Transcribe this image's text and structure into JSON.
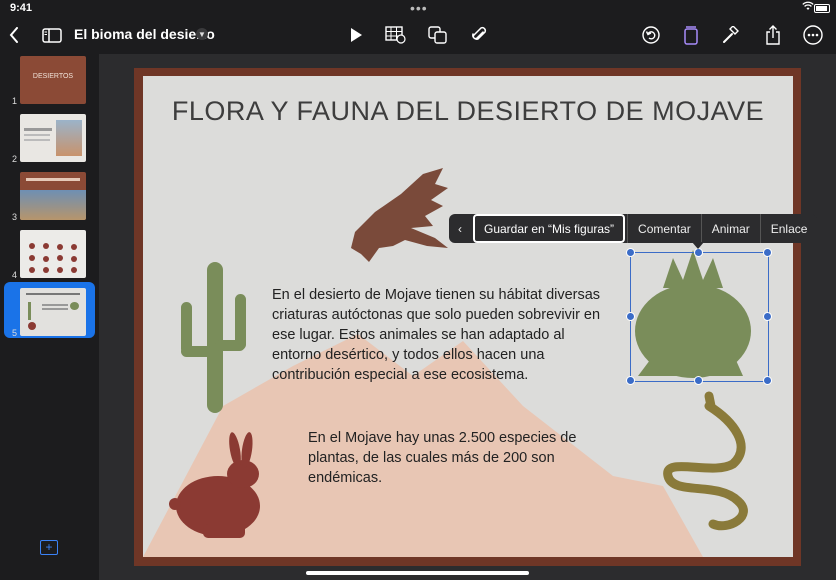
{
  "status": {
    "time": "9:41"
  },
  "toolbar": {
    "title": "El bioma del desierto"
  },
  "sidebar": {
    "slides": [
      {
        "number": "1",
        "thumb_text": "DESIERTOS"
      },
      {
        "number": "2"
      },
      {
        "number": "3"
      },
      {
        "number": "4"
      },
      {
        "number": "5"
      }
    ]
  },
  "slide": {
    "title": "FLORA Y FAUNA DEL DESIERTO DE MOJAVE",
    "paragraph1": "En el desierto de Mojave tienen su hábitat diversas criaturas autóctonas que solo pueden sobrevivir en ese lugar. Estos animales se han adaptado al entorno desértico, y todos ellos hacen una contribución especial a ese ecosistema.",
    "paragraph2": "En el Mojave hay unas 2.500 especies de plantas, de las cuales más de 200 son endémicas."
  },
  "context_menu": {
    "back": "‹",
    "save": "Guardar en “Mis figuras”",
    "comment": "Comentar",
    "animate": "Animar",
    "link": "Enlace"
  },
  "colors": {
    "accent": "#1a73e8",
    "slide_border": "#6f3626",
    "cactus": "#7a8d5a",
    "rabbit": "#8b3a33",
    "bird": "#7a4a3a",
    "snake": "#8a7a3a",
    "mountain": "#e8c6b4"
  }
}
